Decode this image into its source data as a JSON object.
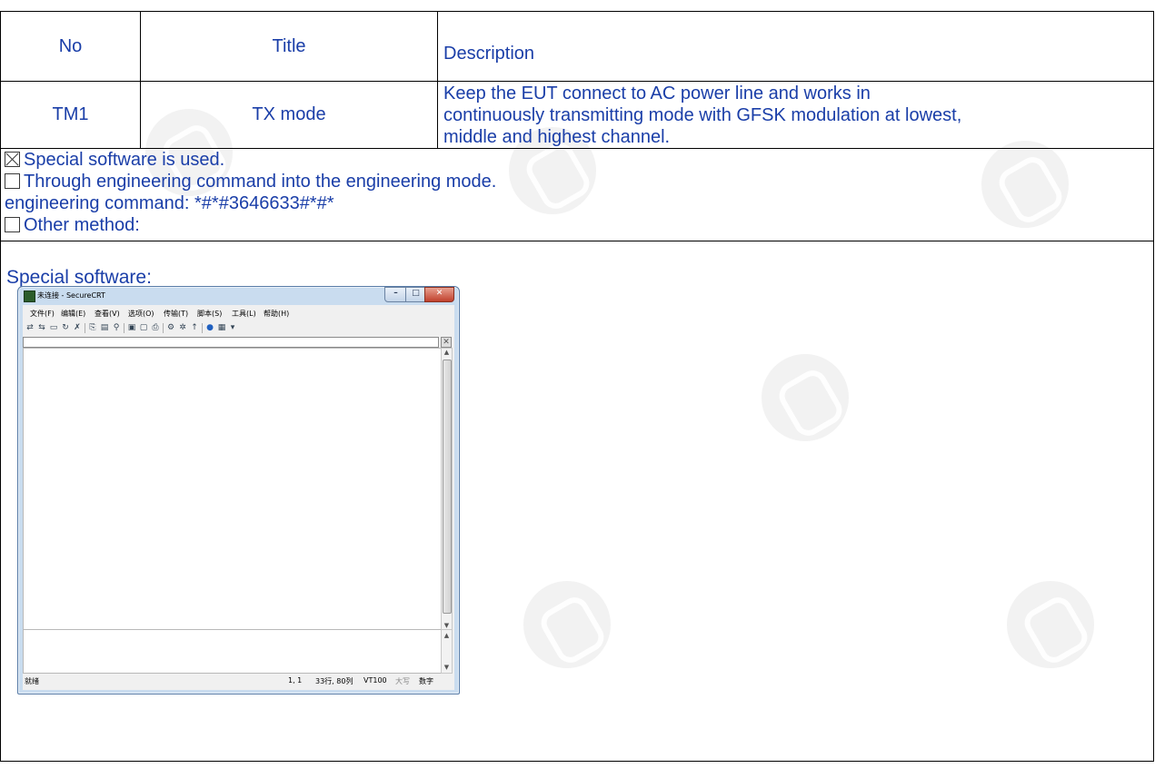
{
  "table": {
    "headers": {
      "no": "No",
      "title": "Title",
      "description": "Description"
    },
    "rows": [
      {
        "no": "TM1",
        "title": "TX mode",
        "description_lines": [
          "Keep the EUT connect to AC power line and works in",
          "continuously transmitting mode with GFSK modulation at lowest,",
          "middle and highest channel."
        ]
      }
    ]
  },
  "method": {
    "option1": {
      "checked": true,
      "label": "Special software is used."
    },
    "option2": {
      "checked": false,
      "label": "Through engineering command into the engineering mode."
    },
    "engineering_command": "engineering command: *#*#3646633#*#*",
    "option3": {
      "checked": false,
      "label": "Other method:"
    }
  },
  "software_label": "Special software:",
  "securecrt": {
    "title": "未连接 - SecureCRT",
    "menu": [
      "文件(F)",
      "编辑(E)",
      "查看(V)",
      "选项(O)",
      "传输(T)",
      "脚本(S)",
      "工具(L)",
      "帮助(H)"
    ],
    "status": {
      "ready": "就绪",
      "position": "1,  1",
      "size": "33行, 80列",
      "emulation": "VT100",
      "caps": "大写",
      "num": "数字"
    }
  },
  "colors": {
    "text_blue": "#1a3ea8",
    "border": "#000000"
  }
}
